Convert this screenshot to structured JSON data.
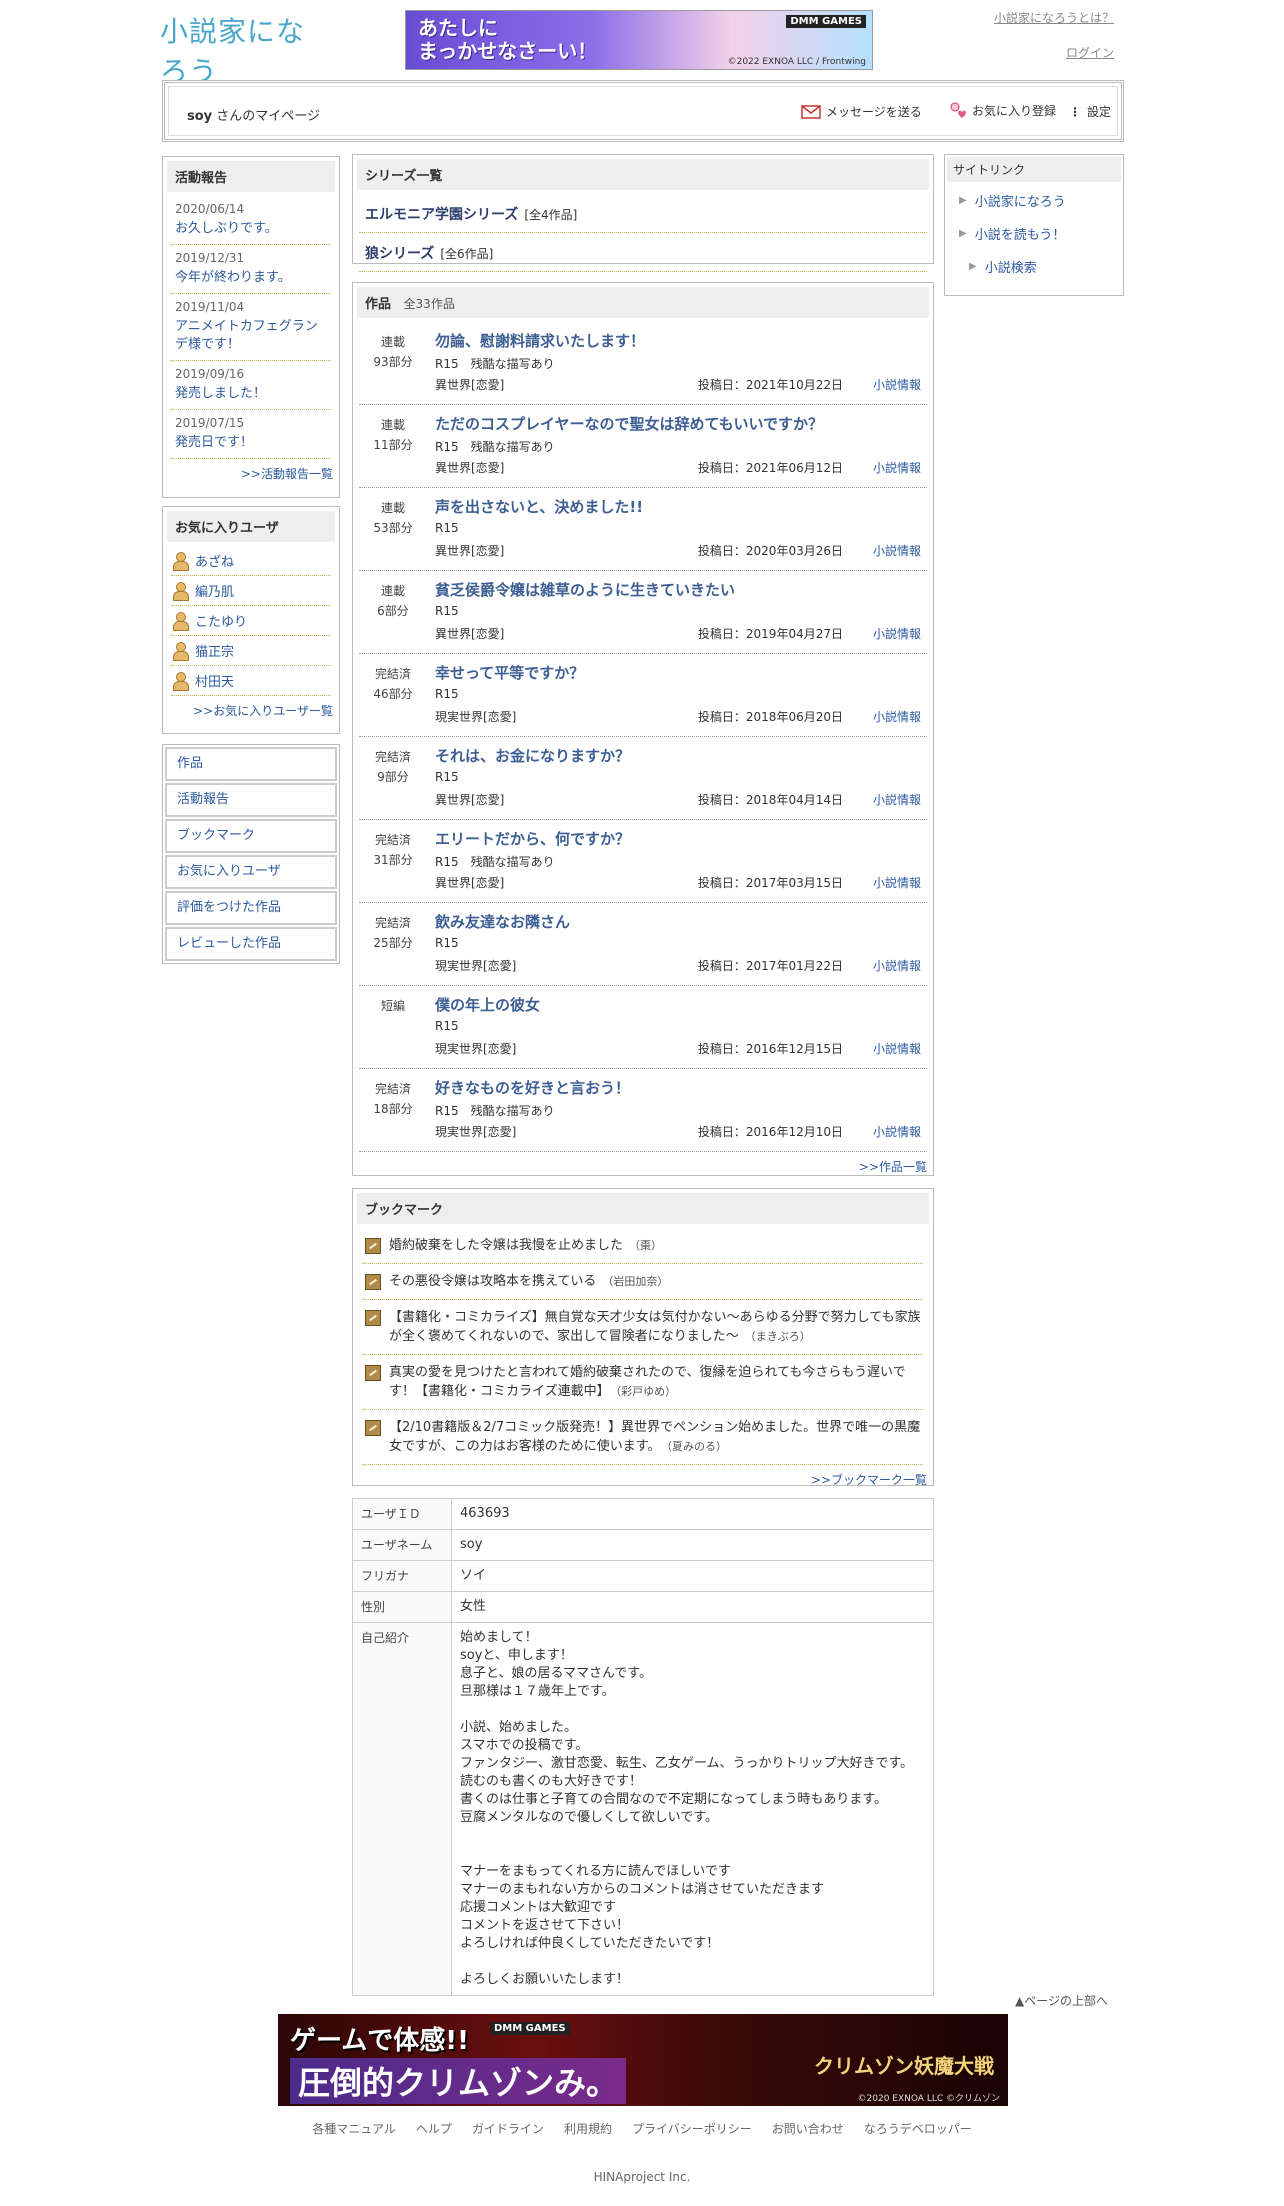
{
  "header": {
    "logo_text": "小説家になろう",
    "about_link": "小説家になろうとは？",
    "login_link": "ログイン",
    "banner": {
      "headline_1": "あたしに",
      "headline_2": "まっかせなさーい！",
      "sponsor": "DMM GAMES",
      "copyright": "©2022 EXNOA LLC / Frontwing"
    }
  },
  "profile_bar": {
    "user_name": "soy",
    "mypage_suffix": "さんのマイページ",
    "send_message": "メッセージを送る",
    "favorite_register": "お気に入り登録",
    "settings": "設定"
  },
  "activity": {
    "title": "活動報告",
    "items": [
      {
        "date": "2020/06/14",
        "title": "お久しぶりです。"
      },
      {
        "date": "2019/12/31",
        "title": "今年が終わります。"
      },
      {
        "date": "2019/11/04",
        "title": "アニメイトカフェグランデ様です！"
      },
      {
        "date": "2019/09/16",
        "title": "発売しました！"
      },
      {
        "date": "2019/07/15",
        "title": "発売日です！"
      }
    ],
    "more": ">>活動報告一覧"
  },
  "favorites": {
    "title": "お気に入りユーザ",
    "users": [
      "あざね",
      "編乃肌",
      "こたゆり",
      "猫正宗",
      "村田天"
    ],
    "more": ">>お気に入りユーザー覧"
  },
  "nav": [
    "作品",
    "活動報告",
    "ブックマーク",
    "お気に入りユーザ",
    "評価をつけた作品",
    "レビューした作品"
  ],
  "series": {
    "title": "シリーズ一覧",
    "items": [
      {
        "name": "エルモニア学園シリーズ",
        "count": "[全4作品]"
      },
      {
        "name": "狼シリーズ",
        "count": "[全6作品]"
      }
    ]
  },
  "works": {
    "title": "作品",
    "count": "全33作品",
    "items": [
      {
        "status": "連載",
        "parts": "93部分",
        "title": "勿論、慰謝料請求いたします！",
        "tags": "R15　残酷な描写あり",
        "genre": "異世界[恋愛]",
        "date": "投稿日：2021年10月22日",
        "info": "小説情報"
      },
      {
        "status": "連載",
        "parts": "11部分",
        "title": "ただのコスプレイヤーなので聖女は辞めてもいいですか？",
        "tags": "R15　残酷な描写あり",
        "genre": "異世界[恋愛]",
        "date": "投稿日：2021年06月12日",
        "info": "小説情報"
      },
      {
        "status": "連載",
        "parts": "53部分",
        "title": "声を出さないと、決めました!!",
        "tags": "R15",
        "genre": "異世界[恋愛]",
        "date": "投稿日：2020年03月26日",
        "info": "小説情報"
      },
      {
        "status": "連載",
        "parts": "6部分",
        "title": "貧乏侯爵令嬢は雑草のように生きていきたい",
        "tags": "R15",
        "genre": "異世界[恋愛]",
        "date": "投稿日：2019年04月27日",
        "info": "小説情報"
      },
      {
        "status": "完結済",
        "parts": "46部分",
        "title": "幸せって平等ですか？",
        "tags": "R15",
        "genre": "現実世界[恋愛]",
        "date": "投稿日：2018年06月20日",
        "info": "小説情報"
      },
      {
        "status": "完結済",
        "parts": "9部分",
        "title": "それは、お金になりますか？",
        "tags": "R15",
        "genre": "異世界[恋愛]",
        "date": "投稿日：2018年04月14日",
        "info": "小説情報"
      },
      {
        "status": "完結済",
        "parts": "31部分",
        "title": "エリートだから、何ですか？",
        "tags": "R15　残酷な描写あり",
        "genre": "異世界[恋愛]",
        "date": "投稿日：2017年03月15日",
        "info": "小説情報"
      },
      {
        "status": "完結済",
        "parts": "25部分",
        "title": "飲み友達なお隣さん",
        "tags": "R15",
        "genre": "現実世界[恋愛]",
        "date": "投稿日：2017年01月22日",
        "info": "小説情報"
      },
      {
        "status": "短編",
        "parts": "",
        "title": "僕の年上の彼女",
        "tags": "R15",
        "genre": "現実世界[恋愛]",
        "date": "投稿日：2016年12月15日",
        "info": "小説情報"
      },
      {
        "status": "完結済",
        "parts": "18部分",
        "title": "好きなものを好きと言おう！",
        "tags": "R15　残酷な描写あり",
        "genre": "現実世界[恋愛]",
        "date": "投稿日：2016年12月10日",
        "info": "小説情報"
      }
    ],
    "more": ">>作品一覧"
  },
  "bookmarks": {
    "title": "ブックマーク",
    "items": [
      {
        "title": "婚約破棄をした令嬢は我慢を止めました",
        "author": "（棗）"
      },
      {
        "title": "その悪役令嬢は攻略本を携えている",
        "author": "（岩田加奈）"
      },
      {
        "title": "【書籍化・コミカライズ】無自覚な天才少女は気付かない～あらゆる分野で努力しても家族が全く褒めてくれないので、家出して冒険者になりました～",
        "author": "（まきぶろ）"
      },
      {
        "title": "真実の愛を見つけたと言われて婚約破棄されたので、復縁を迫られても今さらもう遅いです！【書籍化・コミカライズ連載中】",
        "author": "（彩戸ゆめ）"
      },
      {
        "title": "【2/10書籍版＆2/7コミック版発売！】異世界でペンション始めました。世界で唯一の黒魔女ですが、この力はお客様のために使います。",
        "author": "（夏みのる）"
      }
    ],
    "more": ">>ブックマーク一覧"
  },
  "profile": {
    "rows": [
      {
        "label": "ユーザＩＤ",
        "value": "463693"
      },
      {
        "label": "ユーザネーム",
        "value": "soy"
      },
      {
        "label": "フリガナ",
        "value": "ソイ"
      },
      {
        "label": "性別",
        "value": "女性"
      },
      {
        "label": "自己紹介",
        "value": "始めまして！\nsoyと、申します！\n息子と、娘の居るママさんです。\n旦那様は１７歳年上です。\n\n小説、始めました。\nスマホでの投稿です。\nファンタジー、激甘恋愛、転生、乙女ゲーム、うっかりトリップ大好きです。\n読むのも書くのも大好きです！\n書くのは仕事と子育ての合間なので不定期になってしまう時もあります。\n豆腐メンタルなので優しくして欲しいです。\n\n\nマナーをまもってくれる方に読んでほしいです\nマナーのまもれない方からのコメントは消させていただきます\n応援コメントは大歓迎です\nコメントを返させて下さい！\nよろしければ仲良くしていただきたいです！\n\nよろしくお願いいたします！"
      }
    ]
  },
  "site_links": {
    "title": "サイトリンク",
    "items": [
      "小説家になろう",
      "小説を読もう！",
      "小説検索"
    ]
  },
  "page_top": "▲ページの上部へ",
  "footer": {
    "banner": {
      "line1": "ゲームで体感!!",
      "line2": "圧倒的クリムゾンみ。",
      "logo": "クリムゾン妖魔大戦",
      "sponsor": "DMM GAMES",
      "copyright": "©2020 EXNOA LLC ©クリムゾン"
    },
    "links": [
      "各種マニュアル",
      "ヘルプ",
      "ガイドライン",
      "利用規約",
      "プライバシーポリシー",
      "お問い合わせ",
      "なろうデベロッパー"
    ],
    "company": "HINAproject Inc."
  },
  "colors": {
    "link": "#2c5aa0",
    "work_title": "#3e5f93",
    "dotted_accent": "#c9b24a"
  }
}
